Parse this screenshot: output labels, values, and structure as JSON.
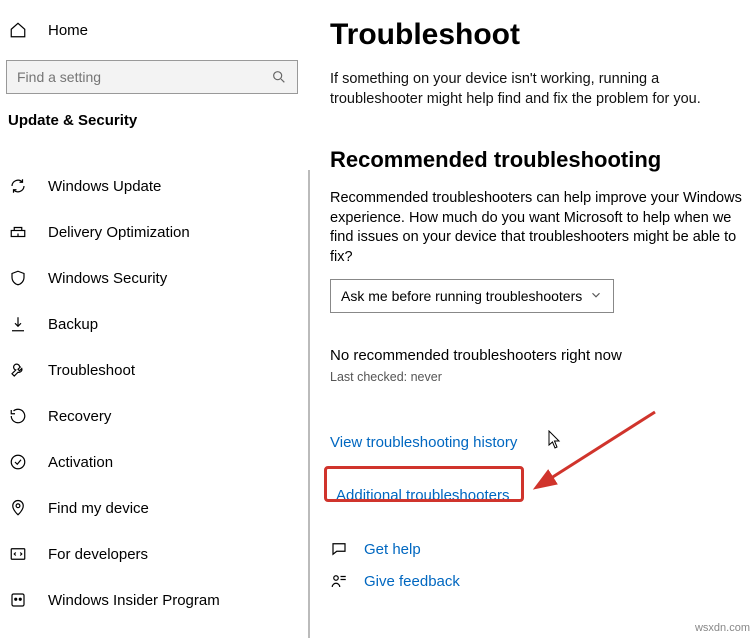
{
  "sidebar": {
    "home_label": "Home",
    "search_placeholder": "Find a setting",
    "category_label": "Update & Security",
    "items": [
      {
        "label": "Windows Update",
        "icon": "refresh-icon"
      },
      {
        "label": "Delivery Optimization",
        "icon": "delivery-icon"
      },
      {
        "label": "Windows Security",
        "icon": "shield-icon"
      },
      {
        "label": "Backup",
        "icon": "backup-icon"
      },
      {
        "label": "Troubleshoot",
        "icon": "wrench-icon"
      },
      {
        "label": "Recovery",
        "icon": "recovery-icon"
      },
      {
        "label": "Activation",
        "icon": "check-circle-icon"
      },
      {
        "label": "Find my device",
        "icon": "location-icon"
      },
      {
        "label": "For developers",
        "icon": "code-icon"
      },
      {
        "label": "Windows Insider Program",
        "icon": "insider-icon"
      }
    ]
  },
  "main": {
    "title": "Troubleshoot",
    "description": "If something on your device isn't working, running a troubleshooter might help find and fix the problem for you.",
    "recommended": {
      "heading": "Recommended troubleshooting",
      "description": "Recommended troubleshooters can help improve your Windows experience. How much do you want Microsoft to help when we find issues on your device that troubleshooters might be able to fix?",
      "dropdown_value": "Ask me before running troubleshooters",
      "status": "No recommended troubleshooters right now",
      "last_checked": "Last checked: never"
    },
    "links": {
      "history": "View troubleshooting history",
      "additional": "Additional troubleshooters",
      "get_help": "Get help",
      "give_feedback": "Give feedback"
    }
  },
  "watermark": "wsxdn.com"
}
